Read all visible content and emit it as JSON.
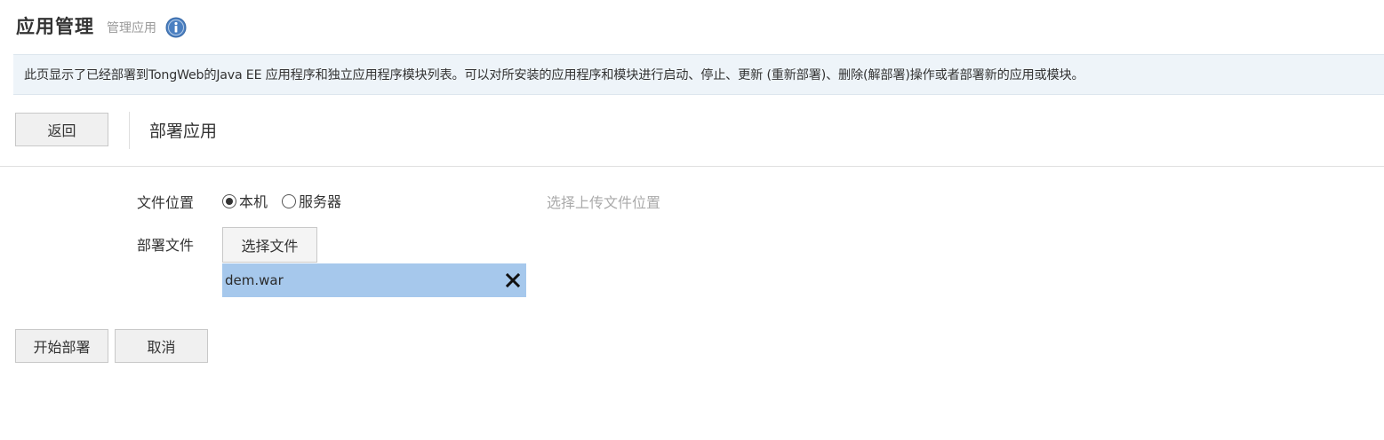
{
  "header": {
    "title": "应用管理",
    "subtitle": "管理应用",
    "info_icon": "info-circle-icon"
  },
  "description": "此页显示了已经部署到TongWeb的Java EE 应用程序和独立应用程序模块列表。可以对所安装的应用程序和模块进行启动、停止、更新 (重新部署)、删除(解部署)操作或者部署新的应用或模块。",
  "toolbar": {
    "back_label": "返回",
    "section_title": "部署应用"
  },
  "form": {
    "location_label": "文件位置",
    "location_options": [
      {
        "label": "本机",
        "checked": true
      },
      {
        "label": "服务器",
        "checked": false
      }
    ],
    "location_hint": "选择上传文件位置",
    "file_label": "部署文件",
    "choose_file_label": "选择文件",
    "selected_file": "dem.war",
    "remove_icon": "close-icon"
  },
  "actions": {
    "start_label": "开始部署",
    "cancel_label": "取消"
  },
  "colors": {
    "description_bg": "#eef4f9",
    "selected_file_bg": "#a6c8ec",
    "info_icon": "#4a7fc1",
    "hint_text": "#aaaaaa"
  }
}
